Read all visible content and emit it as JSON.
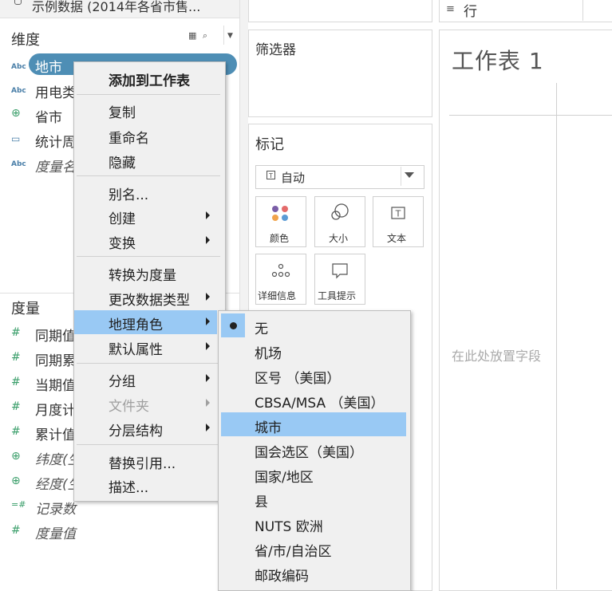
{
  "datasource": {
    "name": "示例数据 (2014年各省市售..."
  },
  "dimensions": {
    "title": "维度",
    "tools": "▦ ⌕",
    "fields": [
      {
        "type": "Abc",
        "label": "地市"
      },
      {
        "type": "Abc",
        "label": "用电类"
      },
      {
        "type": "globe",
        "label": "省市"
      },
      {
        "type": "date",
        "label": "统计周"
      },
      {
        "type": "Abc",
        "label": "度量名"
      }
    ]
  },
  "measures": {
    "title": "度量",
    "fields": [
      {
        "type": "#",
        "label": "同期值"
      },
      {
        "type": "#",
        "label": "同期累"
      },
      {
        "type": "#",
        "label": "当期值"
      },
      {
        "type": "#",
        "label": "月度计"
      },
      {
        "type": "#",
        "label": "累计值"
      },
      {
        "type": "globe",
        "label": "纬度(生"
      },
      {
        "type": "globe",
        "label": "经度(生"
      },
      {
        "type": "=#",
        "label": "记录数"
      },
      {
        "type": "#",
        "label": "度量值"
      }
    ]
  },
  "filters": {
    "title": "筛选器"
  },
  "marks": {
    "title": "标记",
    "mark_type": "自动",
    "buttons": [
      {
        "label": "颜色",
        "icon": "color-dots-icon"
      },
      {
        "label": "大小",
        "icon": "size-circles-icon"
      },
      {
        "label": "文本",
        "icon": "text-icon"
      },
      {
        "label": "详细信息",
        "icon": "detail-dots-icon"
      },
      {
        "label": "工具提示",
        "icon": "tooltip-bubble-icon"
      }
    ]
  },
  "rows_shelf": {
    "label": "行"
  },
  "worksheet": {
    "title": "工作表 1",
    "drop_hint": "在此处放置字段"
  },
  "context_menu": {
    "items": [
      {
        "label": "添加到工作表"
      },
      {
        "label": "复制"
      },
      {
        "label": "重命名"
      },
      {
        "label": "隐藏"
      },
      {
        "label": "别名..."
      },
      {
        "label": "创建"
      },
      {
        "label": "变换"
      },
      {
        "label": "转换为度量"
      },
      {
        "label": "更改数据类型"
      },
      {
        "label": "地理角色"
      },
      {
        "label": "默认属性"
      },
      {
        "label": "分组"
      },
      {
        "label": "文件夹"
      },
      {
        "label": "分层结构"
      },
      {
        "label": "替换引用..."
      },
      {
        "label": "描述..."
      }
    ]
  },
  "geo_submenu": {
    "items": [
      {
        "label": "无"
      },
      {
        "label": "机场"
      },
      {
        "label": "区号 （美国）"
      },
      {
        "label": "CBSA/MSA （美国）"
      },
      {
        "label": "城市"
      },
      {
        "label": "国会选区（美国）"
      },
      {
        "label": "国家/地区"
      },
      {
        "label": "县"
      },
      {
        "label": "NUTS 欧洲"
      },
      {
        "label": "省/市/自治区"
      },
      {
        "label": "邮政编码"
      }
    ]
  },
  "colors": {
    "pill": "#4e8eb5",
    "highlight": "#99c9f4",
    "dot_colors": [
      "#7b5ea7",
      "#e46b6b",
      "#f1a34b",
      "#5b9bd5"
    ]
  }
}
